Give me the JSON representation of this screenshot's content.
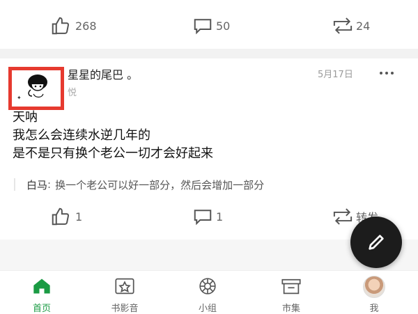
{
  "previous_post": {
    "actions": {
      "like_count": "268",
      "comment_count": "50",
      "repost_count": "24"
    }
  },
  "post": {
    "author_name": "星星的尾巴 。",
    "author_sub": "悦",
    "date": "5月17日",
    "more_icon": "more-icon",
    "content_lines": [
      "天呐",
      "我怎么会连续水逆几年的",
      "是不是只有换个老公一切才会好起来"
    ],
    "comment_preview": {
      "commenter": "白马",
      "text": "换一个老公可以好一部分，然后会增加一部分"
    },
    "actions": {
      "like_count": "1",
      "comment_count": "1",
      "repost_label": "转发"
    }
  },
  "fab": {
    "icon": "pencil-icon"
  },
  "bottom_nav": {
    "items": [
      {
        "label": "首页",
        "icon": "home-icon",
        "active": true
      },
      {
        "label": "书影音",
        "icon": "book-film-music-icon",
        "active": false
      },
      {
        "label": "小组",
        "icon": "group-icon",
        "active": false
      },
      {
        "label": "市集",
        "icon": "market-icon",
        "active": false
      },
      {
        "label": "我",
        "icon": "profile-avatar",
        "active": false
      }
    ]
  },
  "colors": {
    "accent_green": "#1a9b43",
    "highlight_red": "#e63a2f"
  }
}
